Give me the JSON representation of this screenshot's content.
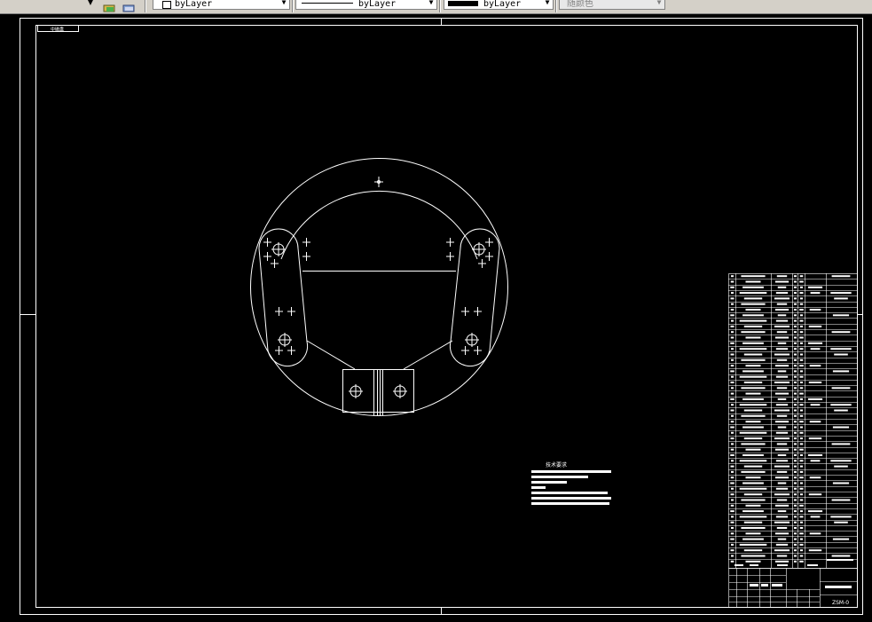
{
  "toolbar": {
    "layer_icon_1": "layer-states-icon",
    "layer_icon_2": "layer-manager-icon",
    "color_value": "byLayer",
    "linetype_value": "byLayer",
    "lineweight_value": "byLayer",
    "plotstyle_value": "随颜色"
  },
  "drawing": {
    "frame_tag": "中磁盘",
    "title_block": {
      "drawing_number": "ZSM-0"
    },
    "tech_notes": {
      "title": "技术要求"
    }
  },
  "colors": {
    "background": "#000000",
    "linework": "#ffffff",
    "toolbar": "#d4d0c8"
  }
}
